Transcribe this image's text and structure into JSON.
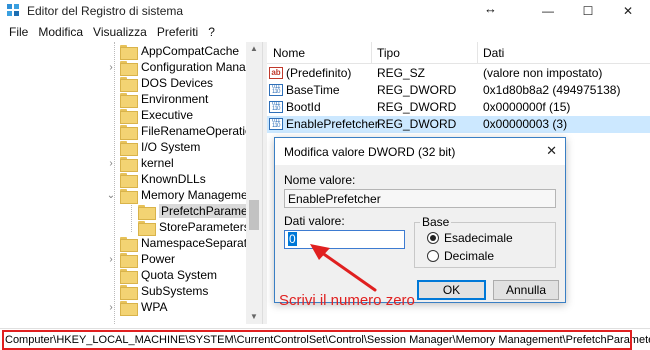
{
  "window": {
    "title": "Editor del Registro di sistema",
    "minimize": "—",
    "maximize": "☐",
    "close": "✕",
    "resize_cursor": "↔"
  },
  "menu": [
    "File",
    "Modifica",
    "Visualizza",
    "Preferiti",
    "?"
  ],
  "tree": {
    "items": [
      {
        "label": "AppCompatCache",
        "chevron": ""
      },
      {
        "label": "Configuration Manage",
        "chevron": "›"
      },
      {
        "label": "DOS Devices",
        "chevron": ""
      },
      {
        "label": "Environment",
        "chevron": ""
      },
      {
        "label": "Executive",
        "chevron": ""
      },
      {
        "label": "FileRenameOperations",
        "chevron": ""
      },
      {
        "label": "I/O System",
        "chevron": ""
      },
      {
        "label": "kernel",
        "chevron": "›"
      },
      {
        "label": "KnownDLLs",
        "chevron": ""
      },
      {
        "label": "Memory Management",
        "chevron": "⌄"
      },
      {
        "label": "PrefetchParameter",
        "chevron": ""
      },
      {
        "label": "StoreParameters",
        "chevron": ""
      },
      {
        "label": "NamespaceSeparation",
        "chevron": ""
      },
      {
        "label": "Power",
        "chevron": "›"
      },
      {
        "label": "Quota System",
        "chevron": ""
      },
      {
        "label": "SubSystems",
        "chevron": ""
      },
      {
        "label": "WPA",
        "chevron": "›"
      }
    ]
  },
  "list": {
    "headers": {
      "name": "Nome",
      "type": "Tipo",
      "data": "Dati"
    },
    "rows": [
      {
        "icon": "ab",
        "name": "(Predefinito)",
        "type": "REG_SZ",
        "data": "(valore non impostato)"
      },
      {
        "icon": "dword",
        "name": "BaseTime",
        "type": "REG_DWORD",
        "data": "0x1d80b8a2 (494975138)"
      },
      {
        "icon": "dword",
        "name": "BootId",
        "type": "REG_DWORD",
        "data": "0x0000000f (15)"
      },
      {
        "icon": "dword",
        "name": "EnablePrefetcher",
        "type": "REG_DWORD",
        "data": "0x00000003 (3)"
      }
    ]
  },
  "icons": {
    "ab": "ab",
    "dword": "011 110"
  },
  "status": {
    "path": "Computer\\HKEY_LOCAL_MACHINE\\SYSTEM\\CurrentControlSet\\Control\\Session Manager\\Memory Management\\PrefetchParameters"
  },
  "dialog": {
    "title": "Modifica valore DWORD (32 bit)",
    "close": "✕",
    "name_label": "Nome valore:",
    "name_value": "EnablePrefetcher",
    "value_label": "Dati valore:",
    "value_value": "0",
    "base_label": "Base",
    "radio_hex": "Esadecimale",
    "radio_dec": "Decimale",
    "ok": "OK",
    "cancel": "Annulla"
  },
  "annotation": {
    "text": "Scrivi il numero zero"
  },
  "colors": {
    "annotation": "#e02020",
    "selection": "#cce8ff",
    "accent": "#0078d7"
  }
}
